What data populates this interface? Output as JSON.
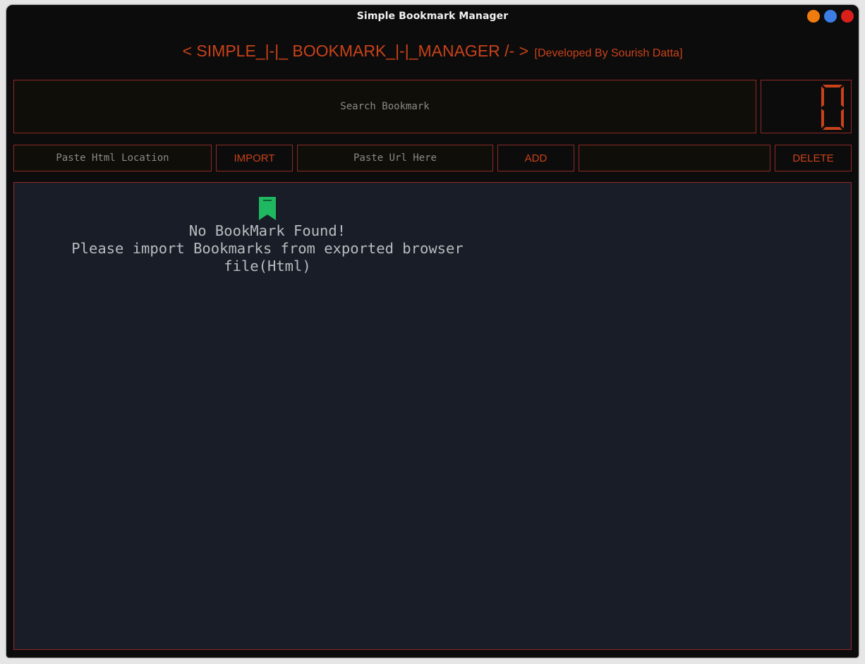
{
  "window": {
    "title": "Simple Bookmark Manager",
    "controls": {
      "minimize_color": "#f07b0f",
      "maximize_color": "#3b7de5",
      "close_color": "#d9201a"
    }
  },
  "header": {
    "title": "< SIMPLE_|-|_ BOOKMARK_|-|_MANAGER /- >",
    "credit": "[Developed By Sourish Datta]"
  },
  "search": {
    "placeholder": "Search Bookmark",
    "value": ""
  },
  "counter": {
    "value": "0"
  },
  "toolbar": {
    "html_location_placeholder": "Paste Html Location",
    "import_label": "IMPORT",
    "url_placeholder": "Paste Url Here",
    "add_label": "ADD",
    "delete_field_placeholder": "",
    "delete_label": "DELETE"
  },
  "empty_state": {
    "icon": "bookmark-icon",
    "line1": "No BookMark Found!",
    "line2": "Please import Bookmarks from exported browser file(Html)"
  },
  "colors": {
    "accent": "#c9421a",
    "border": "#8f2a26",
    "icon_green": "#1fb860",
    "content_bg": "#181d27",
    "window_bg": "#0c0c0c"
  }
}
